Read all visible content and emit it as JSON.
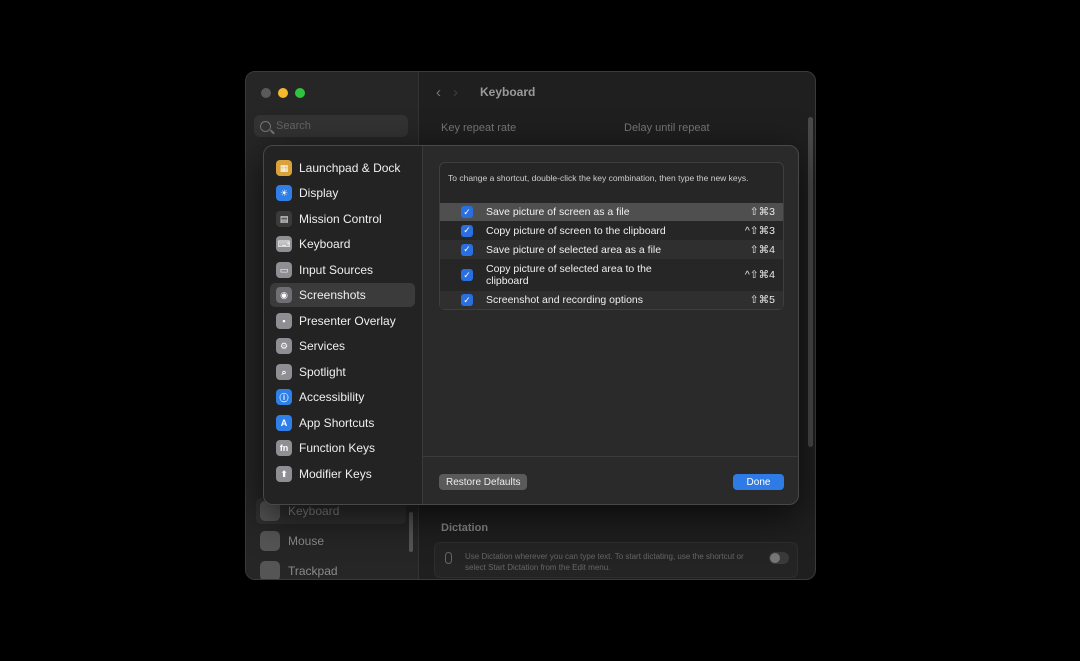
{
  "window": {
    "title": "Keyboard",
    "search_placeholder": "Search",
    "key_repeat_label": "Key repeat rate",
    "delay_label": "Delay until repeat",
    "dictation_label": "Dictation",
    "dictation_text": "Use Dictation wherever you can type text. To start dictating, use the shortcut or select Start Dictation from the Edit menu."
  },
  "sidebar": {
    "visible_items": [
      {
        "label": "Keyboard",
        "icon": "keyboard-icon",
        "selected": true
      },
      {
        "label": "Mouse",
        "icon": "mouse-icon",
        "selected": false
      },
      {
        "label": "Trackpad",
        "icon": "trackpad-icon",
        "selected": false
      }
    ]
  },
  "sheet": {
    "categories": [
      {
        "label": "Launchpad & Dock",
        "icon": "launchpad-icon",
        "color": "#d9a23a",
        "glyph": "▦",
        "selected": false
      },
      {
        "label": "Display",
        "icon": "display-icon",
        "color": "#2f7fe8",
        "glyph": "☀",
        "selected": false
      },
      {
        "label": "Mission Control",
        "icon": "mission-control-icon",
        "color": "#3a3a3a",
        "glyph": "▤",
        "selected": false
      },
      {
        "label": "Keyboard",
        "icon": "keyboard-icon",
        "color": "#8e8e93",
        "glyph": "⌨",
        "selected": false
      },
      {
        "label": "Input Sources",
        "icon": "input-sources-icon",
        "color": "#8e8e93",
        "glyph": "▭",
        "selected": false
      },
      {
        "label": "Screenshots",
        "icon": "screenshot-icon",
        "color": "#6e6e73",
        "glyph": "◉",
        "selected": true
      },
      {
        "label": "Presenter Overlay",
        "icon": "presenter-overlay-icon",
        "color": "#8e8e93",
        "glyph": "▪",
        "selected": false
      },
      {
        "label": "Services",
        "icon": "services-icon",
        "color": "#8e8e93",
        "glyph": "⚙",
        "selected": false
      },
      {
        "label": "Spotlight",
        "icon": "spotlight-icon",
        "color": "#8e8e93",
        "glyph": "⌕",
        "selected": false
      },
      {
        "label": "Accessibility",
        "icon": "accessibility-icon",
        "color": "#2f7fe8",
        "glyph": "ⓘ",
        "selected": false
      },
      {
        "label": "App Shortcuts",
        "icon": "app-shortcuts-icon",
        "color": "#2f7fe8",
        "glyph": "A",
        "selected": false
      },
      {
        "label": "Function Keys",
        "icon": "function-keys-icon",
        "color": "#8e8e93",
        "glyph": "fn",
        "selected": false
      },
      {
        "label": "Modifier Keys",
        "icon": "modifier-keys-icon",
        "color": "#8e8e93",
        "glyph": "⬆",
        "selected": false
      }
    ],
    "instructions": "To change a shortcut, double-click the key combination, then type the new keys.",
    "shortcuts": [
      {
        "label": "Save picture of screen as a file",
        "keys": "⇧⌘3",
        "checked": true
      },
      {
        "label": "Copy picture of screen to the clipboard",
        "keys": "^⇧⌘3",
        "checked": true
      },
      {
        "label": "Save picture of selected area as a file",
        "keys": "⇧⌘4",
        "checked": true
      },
      {
        "label": "Copy picture of selected area to the clipboard",
        "keys": "^⇧⌘4",
        "checked": true
      },
      {
        "label": "Screenshot and recording options",
        "keys": "⇧⌘5",
        "checked": true
      }
    ],
    "restore_label": "Restore Defaults",
    "done_label": "Done",
    "checkmark": "✓"
  }
}
